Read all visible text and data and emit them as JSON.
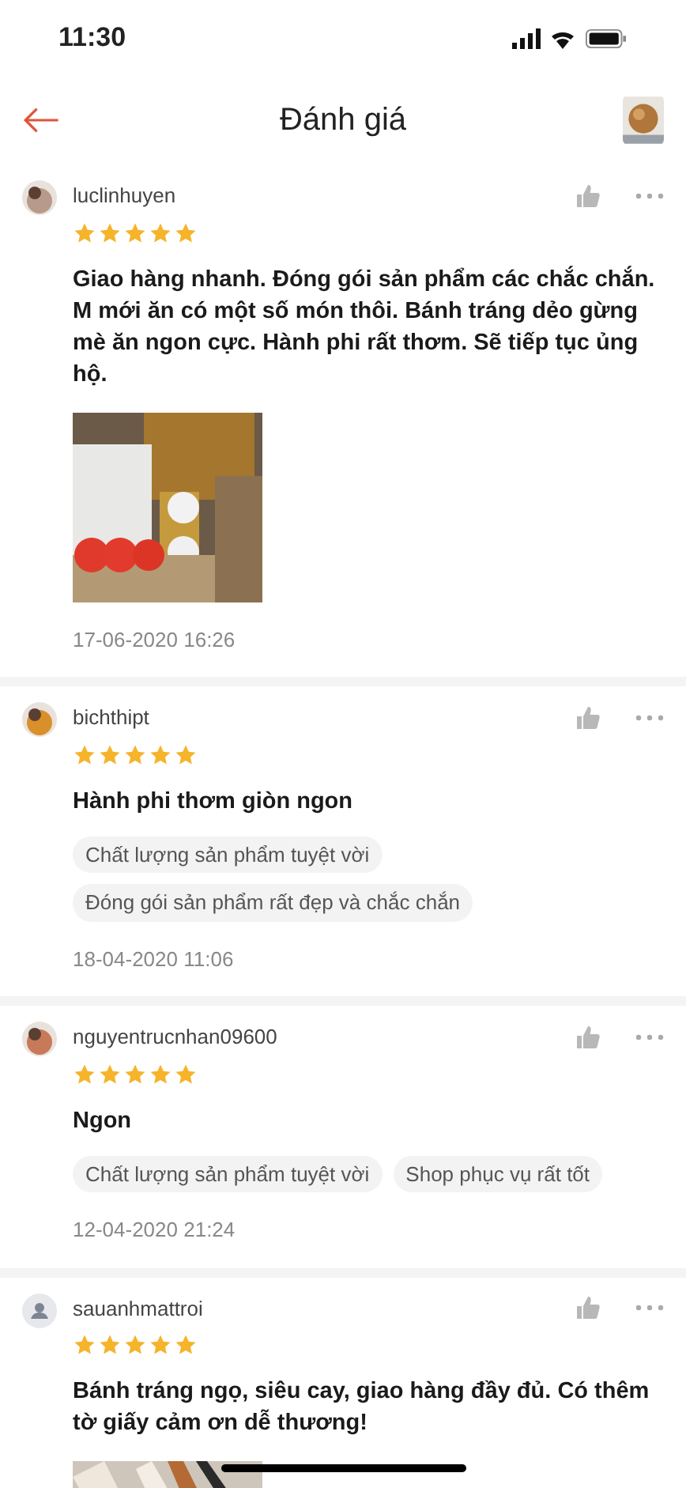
{
  "status_bar": {
    "time": "11:30"
  },
  "header": {
    "title": "Đánh giá"
  },
  "reviews": [
    {
      "user": "luclinhuyen",
      "avatar_photo": true,
      "stars": 5,
      "text": "Giao hàng nhanh. Đóng gói sản phẩm các chắc chắn. M mới ăn có một số món thôi. Bánh tráng dẻo gừng mè ăn ngon cực. Hành phi rất thơm. Sẽ tiếp tục ủng hộ.",
      "has_photo": true,
      "date": "17-06-2020 16:26"
    },
    {
      "user": "bichthipt",
      "avatar_photo": true,
      "stars": 5,
      "text": "Hành phi thơm giòn ngon",
      "tags": [
        "Chất lượng sản phẩm tuyệt vời",
        "Đóng gói sản phẩm rất đẹp và chắc chắn"
      ],
      "has_photo": false,
      "date": "18-04-2020 11:06"
    },
    {
      "user": "nguyentrucnhan09600",
      "avatar_photo": true,
      "stars": 5,
      "text": "Ngon",
      "tags": [
        "Chất lượng sản phẩm tuyệt vời",
        "Shop phục vụ rất tốt"
      ],
      "has_photo": false,
      "date": "12-04-2020 21:24"
    },
    {
      "user": "sauanhmattroi",
      "avatar_photo": false,
      "stars": 5,
      "text": "Bánh tráng ngọ, siêu cay, giao hàng đầy đủ. Có thêm tờ giấy cảm ơn dễ thương!",
      "has_photo": true
    }
  ]
}
